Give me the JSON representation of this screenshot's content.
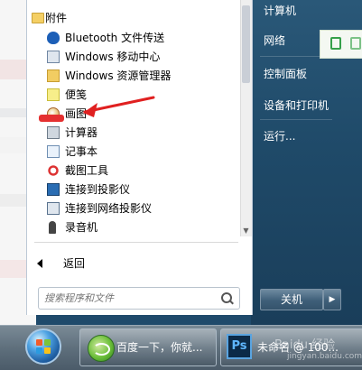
{
  "menu": {
    "folder": {
      "label": "附件",
      "icon": "folder-icon"
    },
    "items": [
      {
        "label": "Bluetooth 文件传送",
        "icon": "bluetooth-icon"
      },
      {
        "label": "Windows 移动中心",
        "icon": "mobility-center-icon"
      },
      {
        "label": "Windows 资源管理器",
        "icon": "explorer-folder-icon"
      },
      {
        "label": "便笺",
        "icon": "sticky-note-icon"
      },
      {
        "label": "画图",
        "icon": "paint-icon"
      },
      {
        "label": "计算器",
        "icon": "calculator-icon"
      },
      {
        "label": "记事本",
        "icon": "notepad-icon"
      },
      {
        "label": "截图工具",
        "icon": "scissors-icon"
      },
      {
        "label": "连接到投影仪",
        "icon": "projector-icon"
      },
      {
        "label": "连接到网络投影仪",
        "icon": "network-projector-icon"
      },
      {
        "label": "录音机",
        "icon": "microphone-icon"
      }
    ],
    "back_label": "返回",
    "search_placeholder": "搜索程序和文件"
  },
  "right_pane": {
    "items": [
      "计算机",
      "网络",
      "控制面板",
      "设备和打印机",
      "运行..."
    ],
    "shutdown_label": "关机",
    "shutdown_arrow": "▶"
  },
  "taskbar": {
    "buttons": [
      {
        "label": "百度一下，你就...",
        "icon": "ie-browser-icon"
      },
      {
        "label": "未命名 @ 100...",
        "icon": "photoshop-icon",
        "icon_text": "Ps"
      }
    ]
  },
  "watermark": {
    "text": "Baidu 经验",
    "url": "jingyan.baidu.com"
  },
  "colors": {
    "annotation_arrow": "#e02020",
    "highlight_bar": "#e53030"
  }
}
